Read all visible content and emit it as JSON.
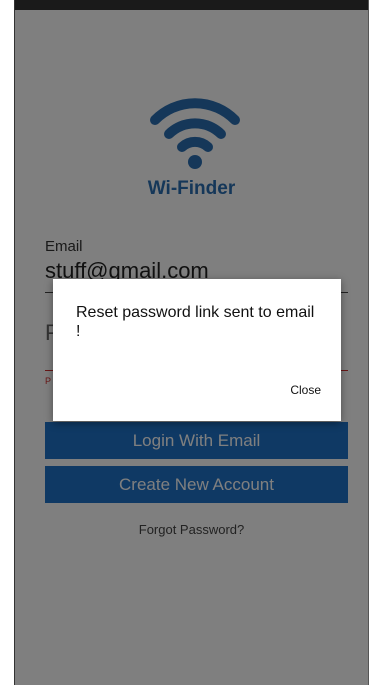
{
  "app": {
    "title": "Wi-Finder",
    "brand_color": "#2a6fb3",
    "logo_icon": "wifi-icon"
  },
  "form": {
    "email_label": "Email",
    "email_value": "stuff@gmail.com",
    "password_hint": "P",
    "error_mark": "P"
  },
  "buttons": {
    "login_label": "Login With Email",
    "create_label": "Create New Account",
    "button_color": "#1f73c9"
  },
  "links": {
    "forgot_password": "Forgot Password?"
  },
  "dialog": {
    "message": "Reset password link sent to email !",
    "close_label": "Close"
  }
}
